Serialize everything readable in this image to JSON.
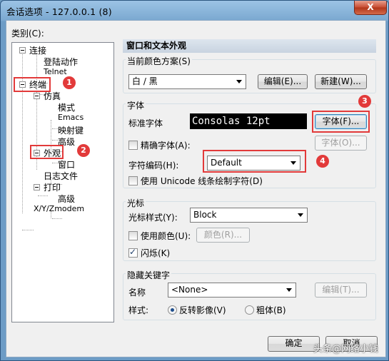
{
  "window": {
    "title": "会话选项 - 127.0.0.1 (8)",
    "close_label": "X"
  },
  "category_label": "类别(C):",
  "tree": {
    "connection": "连接",
    "login_actions": "登陆动作",
    "telnet": "Telnet",
    "terminal": "终端",
    "emulation": "仿真",
    "modes": "模式",
    "emacs": "Emacs",
    "mapped_keys": "映射键",
    "advanced_emulation": "高级",
    "appearance": "外观",
    "window": "窗口",
    "log_file": "日志文件",
    "printing": "打印",
    "advanced_printing": "高级",
    "xyz_modem": "X/Y/Zmodem"
  },
  "panel": {
    "header": "窗口和文本外观",
    "scheme": {
      "label": "当前颜色方案(S)",
      "value": "白 / 黑",
      "edit_button": "编辑(E)...",
      "new_button": "新建(W)..."
    },
    "font": {
      "group_title": "字体",
      "standard_label": "标准字体",
      "preview": "Consolas 12pt",
      "font_button": "字体(F)...",
      "precise_label": "精确字体(A):",
      "precise_button": "字体(O)...",
      "encoding_label": "字符编码(H):",
      "encoding_value": "Default",
      "unicode_label": "使用 Unicode 线条绘制字符(D)"
    },
    "cursor": {
      "group_title": "光标",
      "style_label": "光标样式(Y):",
      "style_value": "Block",
      "use_color_label": "使用颜色(U):",
      "color_button": "颜色(R)...",
      "blink_label": "闪烁(K)",
      "blink_checked": true
    },
    "hidden": {
      "group_title": "隐藏关键字",
      "name_label": "名称",
      "name_value": "<None>",
      "edit_button": "编辑(T)...",
      "style_label": "样式:",
      "reverse_label": "反转影像(V)",
      "bold_label": "粗体(B)",
      "selected": "reverse"
    }
  },
  "buttons": {
    "ok": "确定",
    "cancel": "取消"
  },
  "annotations": [
    "1",
    "2",
    "3",
    "4"
  ],
  "watermark": "头条@网络小钱",
  "colors": {
    "highlight": "#e23a3a",
    "preview_bg": "#000000",
    "preview_fg": "#ffffff"
  }
}
